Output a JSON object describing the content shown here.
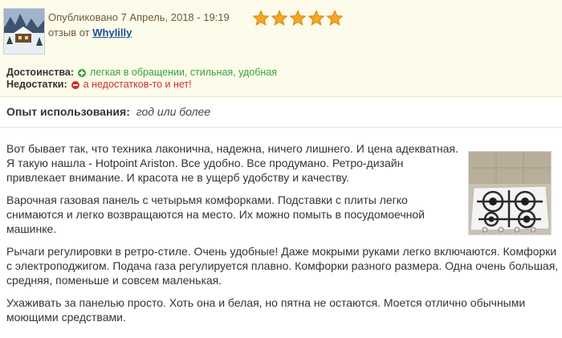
{
  "header": {
    "published": "Опубликовано 7 Апрель, 2018 - 19:19",
    "review_by": "отзыв от",
    "author": "Whylilly",
    "rating": 5,
    "star_color": "#f5a623"
  },
  "pros": {
    "label": "Достоинства:",
    "text": "легкая в обращении, стильная, удобная",
    "color": "#36a33a",
    "icon": "plus-circle-icon"
  },
  "cons": {
    "label": "Недостатки:",
    "text": "а недостатков-то и нет!",
    "color": "#d62b2b",
    "icon": "minus-circle-icon"
  },
  "experience": {
    "label": "Опыт использования:",
    "value": "год или более"
  },
  "body": {
    "paragraphs": [
      "Вот бывает так, что техника лаконична, надежна, ничего лишнего. И цена адекватная. Я такую нашла - Hotpoint Ariston. Все удобно. Все продумано. Ретро-дизайн привлекает внимание. И красота не в ущерб удобству и качеству.",
      "Варочная газовая панель с четырьмя комфорками. Подставки с плиты легко снимаются и легко возвращаются на место. Их можно помыть в посудомоечной машинке.",
      "Рычаги регулировки в ретро-стиле. Очень удобные! Даже мокрыми руками легко включаются. Комфорки с электроподжигом. Подача газа регулируется плавно. Комфорки разного размера. Одна очень большая, средняя, поменьше и совсем маленькая.",
      "Ухаживать за панелью просто. Хоть она и белая, но пятна не остаются. Моется отлично обычными моющими средствами."
    ]
  }
}
